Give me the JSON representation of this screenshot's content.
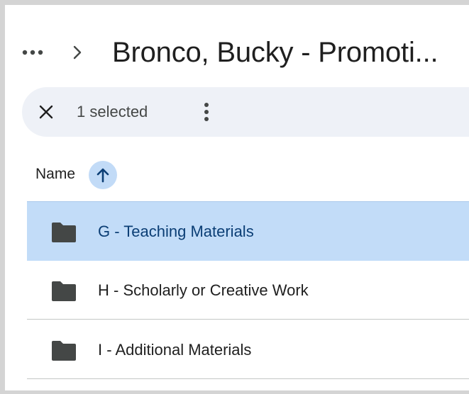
{
  "breadcrumb": {
    "more_icon": "more-horiz-icon",
    "separator_icon": "chevron-right-icon",
    "current_folder": "Bronco, Bucky - Promoti..."
  },
  "selection_bar": {
    "clear_icon": "close-icon",
    "count_label": "1 selected",
    "more_icon": "more-vert-icon"
  },
  "columns": {
    "name_label": "Name",
    "sort_icon": "arrow-upward-icon",
    "sort_direction": "ascending"
  },
  "files": [
    {
      "name": "G - Teaching Materials",
      "type": "folder",
      "selected": true
    },
    {
      "name": "H - Scholarly or Creative Work",
      "type": "folder",
      "selected": false
    },
    {
      "name": "I - Additional Materials",
      "type": "folder",
      "selected": false
    }
  ],
  "colors": {
    "selected_row_bg": "#c2dcf8",
    "selected_text": "#0b3e75",
    "sort_button_bg": "#c2dbf7",
    "selection_bar_bg": "#eef1f7",
    "folder_icon": "#444746"
  }
}
